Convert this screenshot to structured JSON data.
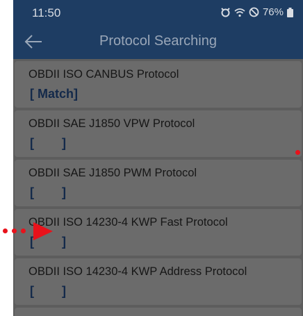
{
  "status_bar": {
    "time": "11:50",
    "battery": "76%",
    "icons": [
      "alarm-icon",
      "wifi-icon",
      "do-not-disturb-icon",
      "battery-icon"
    ]
  },
  "app_bar": {
    "title": "Protocol Searching",
    "back_icon": "arrow-left-icon"
  },
  "protocols": [
    {
      "label": "OBDII ISO CANBUS Protocol",
      "status": "[ Match]"
    },
    {
      "label": "OBDII SAE J1850 VPW Protocol",
      "status": "[        ]"
    },
    {
      "label": "OBDII SAE J1850 PWM Protocol",
      "status": "[        ]"
    },
    {
      "label": "OBDII ISO 14230-4 KWP Fast Protocol",
      "status": "[        ]"
    },
    {
      "label": "OBDII ISO 14230-4 KWP Address Protocol",
      "status": "[        ]"
    }
  ],
  "colors": {
    "header": "#1e3d63",
    "overlay": "#5d5d5d",
    "card": "#6b6b6b",
    "status_text": "#13294a",
    "annotation": "#e8121b"
  }
}
